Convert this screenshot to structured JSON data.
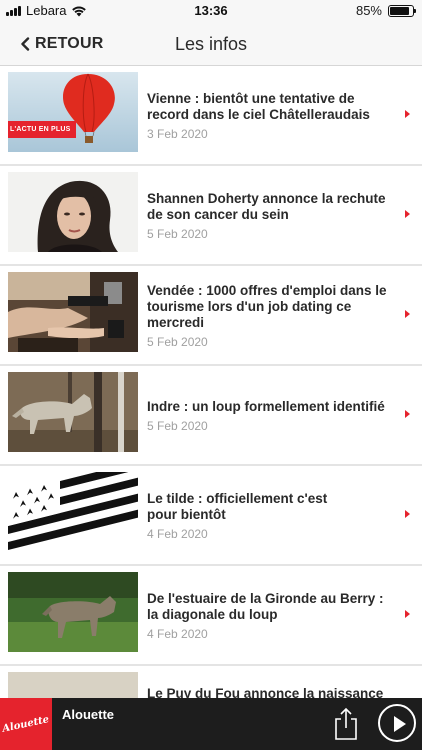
{
  "status_bar": {
    "carrier": "Lebara",
    "time": "13:36",
    "battery_text": "85%",
    "battery_level": 0.85
  },
  "nav": {
    "back_label": "RETOUR",
    "title": "Les infos"
  },
  "colors": {
    "accent": "#e5232d",
    "player_bg": "#1d1d1d",
    "nav_bg": "#f7f7f7"
  },
  "news": [
    {
      "title": "Vienne : bientôt une tentative de record dans le ciel Châtelleraudais",
      "date": "3 Feb 2020",
      "thumb": "hot-air-balloon-image",
      "badge": "L'ACTU EN PLUS"
    },
    {
      "title": "Shannen Doherty annonce la rechute de son cancer du sein",
      "date": "5 Feb 2020",
      "thumb": "portrait-image"
    },
    {
      "title": "Vendée : 1000 offres d'emploi dans le tourisme lors d'un job dating ce mercredi",
      "date": "5 Feb 2020",
      "thumb": "barista-image"
    },
    {
      "title": "Indre : un loup formellement identifié",
      "date": "5 Feb 2020",
      "thumb": "wolf-image"
    },
    {
      "title": "Le tilde : officiellement c'est pour bientôt",
      "date": "4 Feb 2020",
      "thumb": "breton-flag-image"
    },
    {
      "title": "De l'estuaire de la Gironde au Berry : la diagonale du loup",
      "date": "4 Feb 2020",
      "thumb": "wolf-in-grass-image"
    },
    {
      "title": "Le Puy du Fou annonce la naissance",
      "date": "",
      "thumb": ""
    }
  ],
  "player": {
    "logo_text": "Alouette",
    "station": "Alouette",
    "share_icon": "share-icon",
    "play_icon": "play-icon"
  }
}
